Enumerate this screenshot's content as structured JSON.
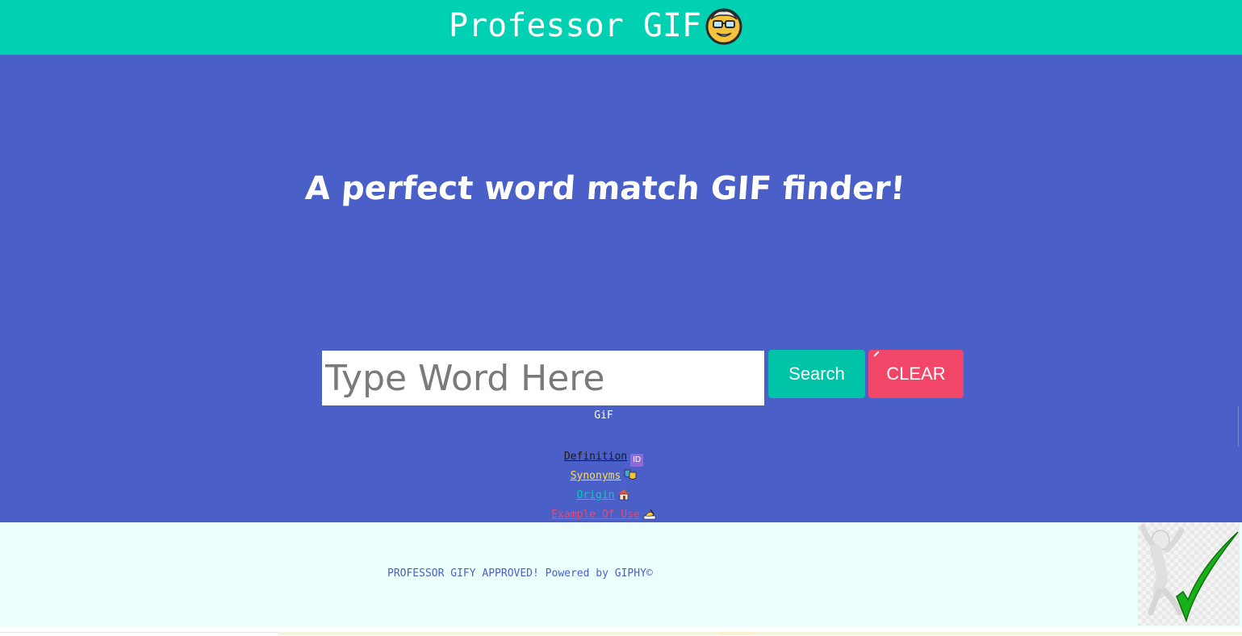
{
  "header": {
    "title": "Professor GIF",
    "logo_icon": "professor-face-icon",
    "background_color": "#00d1b2"
  },
  "hero": {
    "tagline": "A perfect word match GIF finder!",
    "background_color": "#4a5fc8"
  },
  "search": {
    "placeholder": "Type Word Here",
    "value": "",
    "search_button_label": "Search",
    "clear_button_label": "CLEAR",
    "search_button_color": "#00c4a7",
    "clear_button_color": "#f14668"
  },
  "result": {
    "gif_label": "GiF"
  },
  "links": {
    "definition": {
      "label": "Definition",
      "icon": "id-icon",
      "color": "#1a1a1a"
    },
    "synonyms": {
      "label": "Synonyms",
      "icon": "theater-masks-icon",
      "color": "#ffdd57"
    },
    "origin": {
      "label": "Origin",
      "icon": "house-icon",
      "color": "#00d1b2"
    },
    "example": {
      "label": "Example Of Use",
      "icon": "writing-hand-icon",
      "color": "#f14668"
    }
  },
  "footer": {
    "text": "PROFESSOR GIFY APPROVED! Powered by GIPHY©",
    "figure_icon": "jumping-figure-checkmark-icon",
    "background_color": "#ebfffc"
  }
}
